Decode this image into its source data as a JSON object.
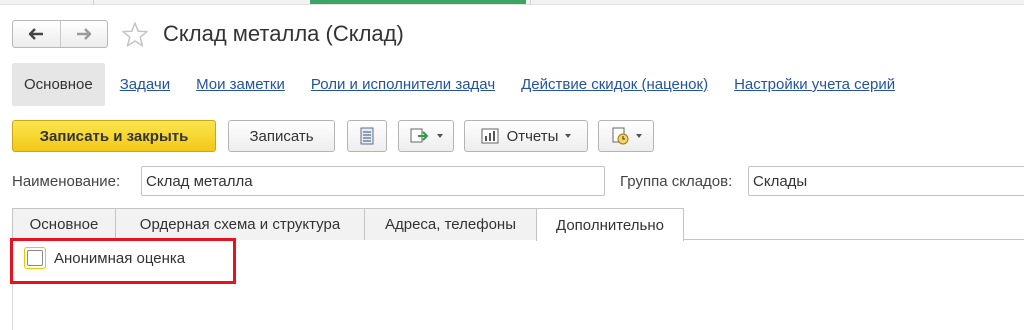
{
  "window": {
    "title": "Склад металла (Склад)"
  },
  "nav": {
    "back_icon": "arrow-left-icon",
    "forward_icon": "arrow-right-icon",
    "favorite_icon": "star-outline-icon"
  },
  "form_links": {
    "active": "Основное",
    "items": [
      "Задачи",
      "Мои заметки",
      "Роли и исполнители задач",
      "Действие скидок (наценок)",
      "Настройки учета серий"
    ]
  },
  "toolbar": {
    "save_close": "Записать и закрыть",
    "save": "Записать",
    "reports": "Отчеты"
  },
  "fields": {
    "name_label": "Наименование:",
    "name_value": "Склад металла",
    "group_label": "Группа складов:",
    "group_value": "Склады"
  },
  "tabs": [
    "Основное",
    "Ордерная схема и структура",
    "Адреса, телефоны",
    "Дополнительно"
  ],
  "active_tab": "Дополнительно",
  "options": {
    "anonymous_label": "Анонимная оценка",
    "anonymous_checked": false
  },
  "colors": {
    "link": "#2453a1",
    "primary_button": "#f3c817",
    "highlight": "#e8111d"
  }
}
